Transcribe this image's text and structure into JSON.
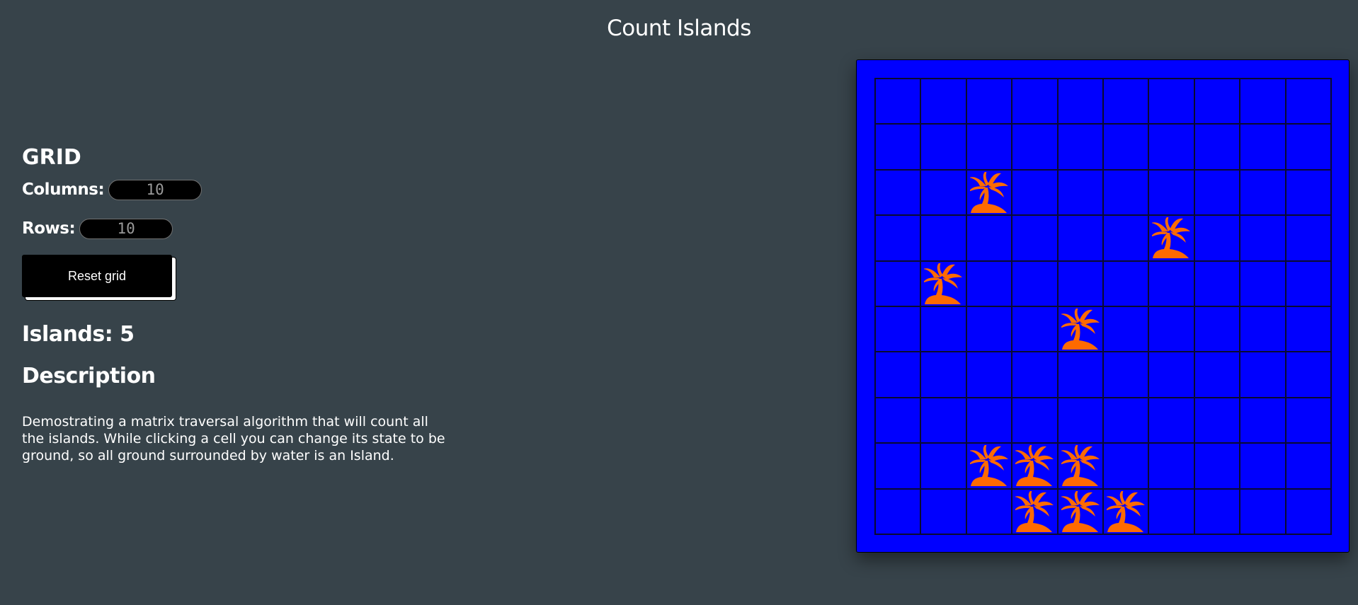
{
  "header": {
    "title": "Count Islands"
  },
  "controls": {
    "heading": "GRID",
    "columns_label": "Columns:",
    "columns_value": "10",
    "rows_label": "Rows:",
    "rows_value": "10",
    "reset_label": "Reset grid"
  },
  "result": {
    "islands_label": "Islands: 5"
  },
  "description": {
    "heading": "Description",
    "text": "Demostrating a matrix traversal algorithm that will count all the islands. While clicking a cell you can change its state to be ground, so all ground surrounded by water is an Island."
  },
  "grid": {
    "columns": 10,
    "rows": 10,
    "water_color": "#0000ff",
    "land_icon": "palm-island-icon",
    "land_color": "#ff6a00",
    "cells": [
      [
        0,
        0,
        0,
        0,
        0,
        0,
        0,
        0,
        0,
        0
      ],
      [
        0,
        0,
        0,
        0,
        0,
        0,
        0,
        0,
        0,
        0
      ],
      [
        0,
        0,
        1,
        0,
        0,
        0,
        0,
        0,
        0,
        0
      ],
      [
        0,
        0,
        0,
        0,
        0,
        0,
        1,
        0,
        0,
        0
      ],
      [
        0,
        1,
        0,
        0,
        0,
        0,
        0,
        0,
        0,
        0
      ],
      [
        0,
        0,
        0,
        0,
        1,
        0,
        0,
        0,
        0,
        0
      ],
      [
        0,
        0,
        0,
        0,
        0,
        0,
        0,
        0,
        0,
        0
      ],
      [
        0,
        0,
        0,
        0,
        0,
        0,
        0,
        0,
        0,
        0
      ],
      [
        0,
        0,
        1,
        1,
        1,
        0,
        0,
        0,
        0,
        0
      ],
      [
        0,
        0,
        0,
        1,
        1,
        1,
        0,
        0,
        0,
        0
      ]
    ]
  }
}
